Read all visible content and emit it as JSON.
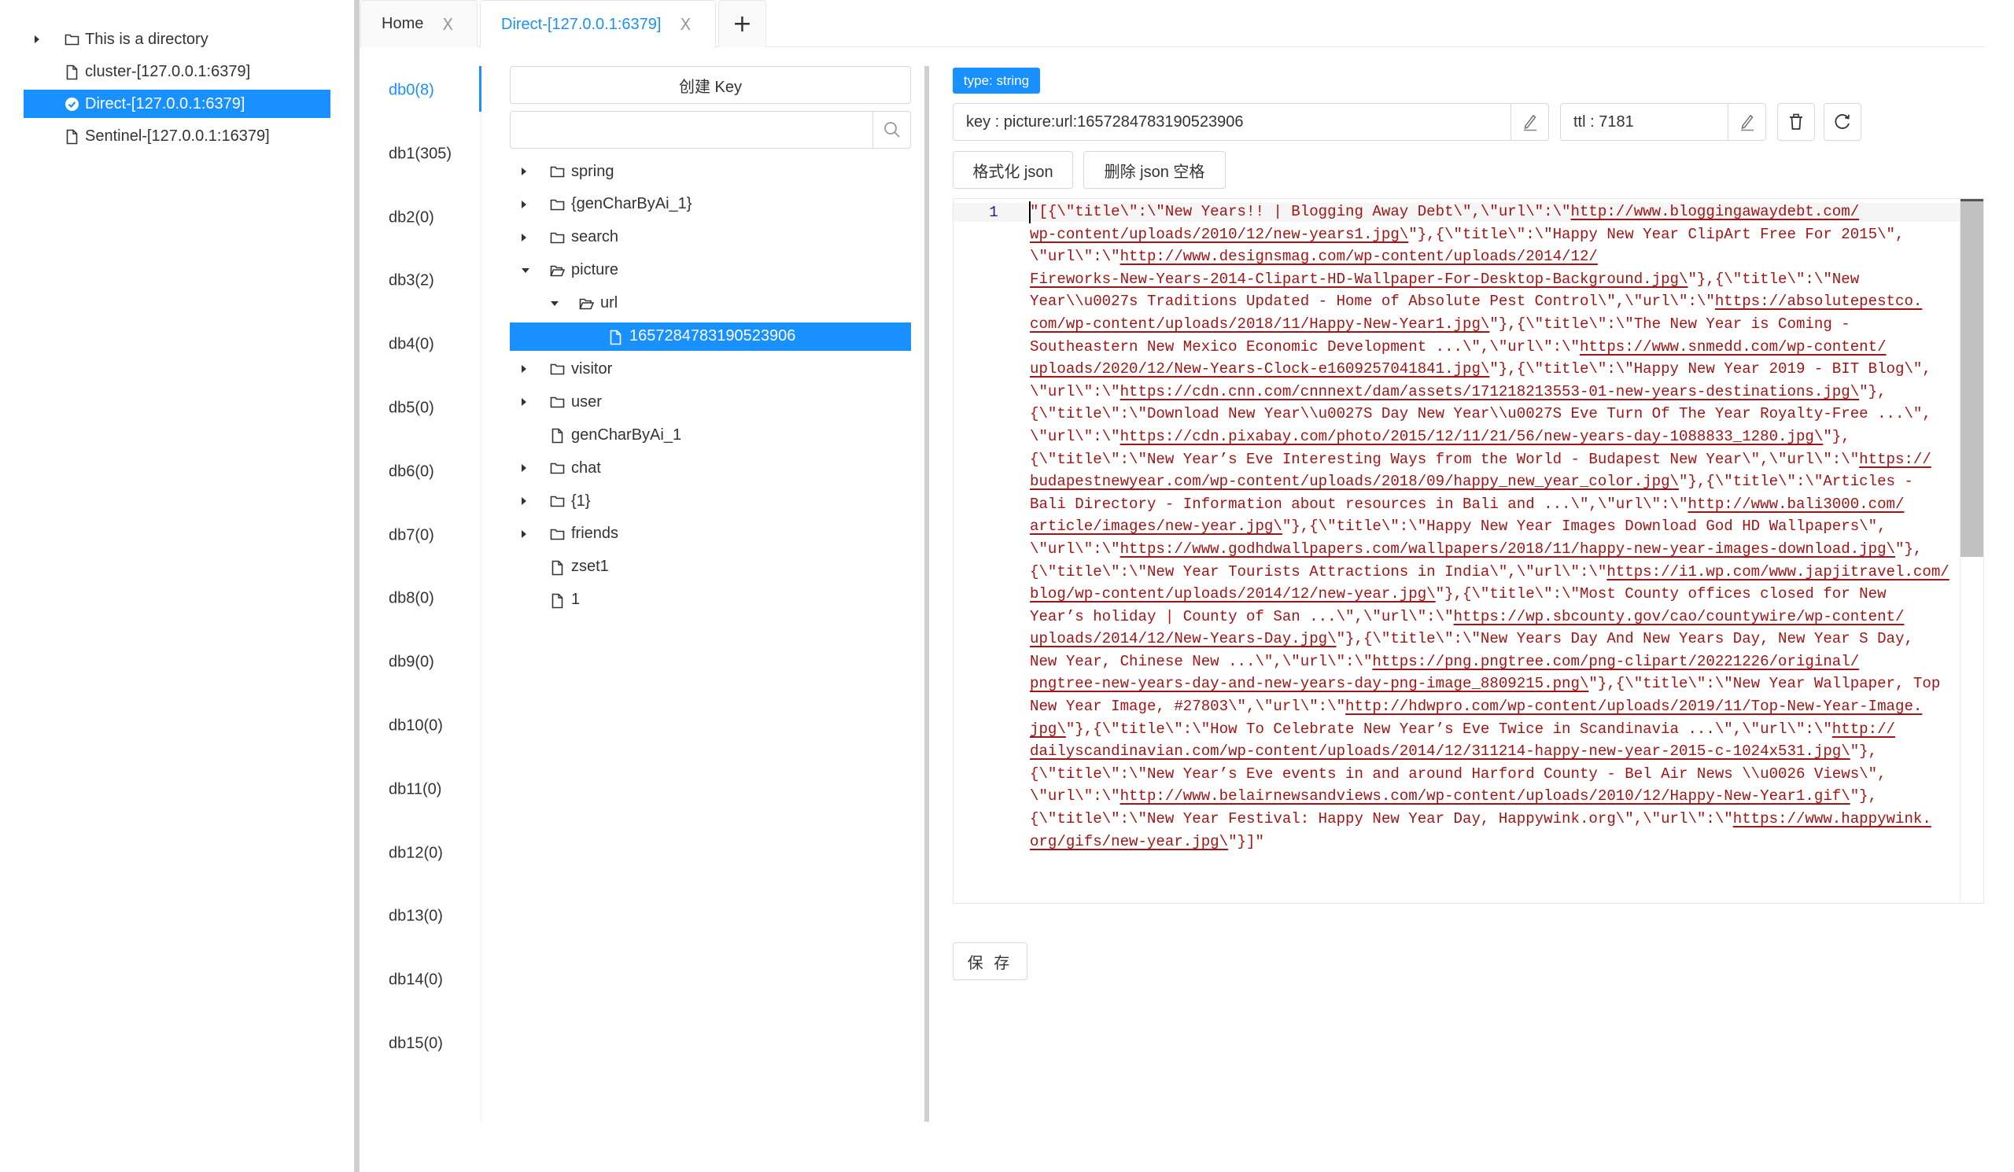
{
  "sidebar": {
    "items": [
      {
        "label": "This is a directory",
        "icon": "folder-icon",
        "expandable": true,
        "selected": false
      },
      {
        "label": "cluster-[127.0.0.1:6379]",
        "icon": "file-icon",
        "expandable": false,
        "selected": false
      },
      {
        "label": "Direct-[127.0.0.1:6379]",
        "icon": "check-circle-icon",
        "expandable": false,
        "selected": true
      },
      {
        "label": "Sentinel-[127.0.0.1:16379]",
        "icon": "file-icon",
        "expandable": false,
        "selected": false
      }
    ]
  },
  "tabs": [
    {
      "label": "Home",
      "close": "X",
      "active": false
    },
    {
      "label": "Direct-[127.0.0.1:6379]",
      "close": "X",
      "active": true
    }
  ],
  "tab_add_label": "+",
  "db_list": [
    {
      "label": "db0(8)",
      "active": true
    },
    {
      "label": "db1(305)"
    },
    {
      "label": "db2(0)"
    },
    {
      "label": "db3(2)"
    },
    {
      "label": "db4(0)"
    },
    {
      "label": "db5(0)"
    },
    {
      "label": "db6(0)"
    },
    {
      "label": "db7(0)"
    },
    {
      "label": "db8(0)"
    },
    {
      "label": "db9(0)"
    },
    {
      "label": "db10(0)"
    },
    {
      "label": "db11(0)"
    },
    {
      "label": "db12(0)"
    },
    {
      "label": "db13(0)"
    },
    {
      "label": "db14(0)"
    },
    {
      "label": "db15(0)"
    }
  ],
  "key_panel": {
    "create_key_label": "创建 Key",
    "search_value": "",
    "search_placeholder": "",
    "tree": [
      {
        "label": "spring",
        "type": "folder",
        "depth": 0,
        "state": "collapsed"
      },
      {
        "label": "{genCharByAi_1}",
        "type": "folder",
        "depth": 0,
        "state": "collapsed"
      },
      {
        "label": "search",
        "type": "folder",
        "depth": 0,
        "state": "collapsed"
      },
      {
        "label": "picture",
        "type": "folder",
        "depth": 0,
        "state": "expanded"
      },
      {
        "label": "url",
        "type": "folder",
        "depth": 1,
        "state": "expanded"
      },
      {
        "label": "1657284783190523906",
        "type": "key",
        "depth": 2,
        "selected": true
      },
      {
        "label": "visitor",
        "type": "folder",
        "depth": 0,
        "state": "collapsed"
      },
      {
        "label": "user",
        "type": "folder",
        "depth": 0,
        "state": "collapsed"
      },
      {
        "label": "genCharByAi_1",
        "type": "key",
        "depth": 0
      },
      {
        "label": "chat",
        "type": "folder",
        "depth": 0,
        "state": "collapsed"
      },
      {
        "label": "{1}",
        "type": "folder",
        "depth": 0,
        "state": "collapsed"
      },
      {
        "label": "friends",
        "type": "folder",
        "depth": 0,
        "state": "collapsed"
      },
      {
        "label": "zset1",
        "type": "key",
        "depth": 0
      },
      {
        "label": "1",
        "type": "key",
        "depth": 0
      }
    ]
  },
  "detail": {
    "type_tag": "type: string",
    "key_text": "key : picture:url:1657284783190523906",
    "ttl_text": "ttl : 7181",
    "format_json_label": "格式化 json",
    "strip_json_label": "删除 json 空格",
    "save_label": "保 存",
    "editor": {
      "line_number": "1",
      "wrapped_lines": [
        [
          [
            "t",
            "\"[{\\\"title\\\":\\\"New Years!! | Blogging Away Debt\\\",\\\"url\\\":\\\""
          ],
          [
            "u",
            "http://www.bloggingawaydebt.com/"
          ]
        ],
        [
          [
            "u",
            "wp-content/uploads/2010/12/new-years1.jpg\\"
          ],
          [
            "t",
            "\"},{\\\"title\\\":\\\"Happy New Year ClipArt Free For 2015\\\","
          ]
        ],
        [
          [
            "t",
            "\\\"url\\\":\\\""
          ],
          [
            "u",
            "http://www.designsmag.com/wp-content/uploads/2014/12/"
          ]
        ],
        [
          [
            "u",
            "Fireworks-New-Years-2014-Clipart-HD-Wallpaper-For-Desktop-Background.jpg\\"
          ],
          [
            "t",
            "\"},{\\\"title\\\":\\\"New"
          ]
        ],
        [
          [
            "t",
            "Year\\\\u0027s Traditions Updated - Home of Absolute Pest Control\\\",\\\"url\\\":\\\""
          ],
          [
            "u",
            "https://absolutepestco."
          ]
        ],
        [
          [
            "u",
            "com/wp-content/uploads/2018/11/Happy-New-Year1.jpg\\"
          ],
          [
            "t",
            "\"},{\\\"title\\\":\\\"The New Year is Coming -"
          ]
        ],
        [
          [
            "t",
            "Southeastern New Mexico Economic Development ...\\\",\\\"url\\\":\\\""
          ],
          [
            "u",
            "https://www.snmedd.com/wp-content/"
          ]
        ],
        [
          [
            "u",
            "uploads/2020/12/New-Years-Clock-e1609257041841.jpg\\"
          ],
          [
            "t",
            "\"},{\\\"title\\\":\\\"Happy New Year 2019 - BIT Blog\\\","
          ]
        ],
        [
          [
            "t",
            "\\\"url\\\":\\\""
          ],
          [
            "u",
            "https://cdn.cnn.com/cnnnext/dam/assets/171218213553-01-new-years-destinations.jpg\\"
          ],
          [
            "t",
            "\"},"
          ]
        ],
        [
          [
            "t",
            "{\\\"title\\\":\\\"Download New Year\\\\u0027S Day New Year\\\\u0027S Eve Turn Of The Year Royalty-Free ...\\\","
          ]
        ],
        [
          [
            "t",
            "\\\"url\\\":\\\""
          ],
          [
            "u",
            "https://cdn.pixabay.com/photo/2015/12/11/21/56/new-years-day-1088833_1280.jpg\\"
          ],
          [
            "t",
            "\"},"
          ]
        ],
        [
          [
            "t",
            "{\\\"title\\\":\\\"New Year’s Eve Interesting Ways from the World - Budapest New Year\\\",\\\"url\\\":\\\""
          ],
          [
            "u",
            "https://"
          ]
        ],
        [
          [
            "u",
            "budapestnewyear.com/wp-content/uploads/2018/09/happy_new_year_color.jpg\\"
          ],
          [
            "t",
            "\"},{\\\"title\\\":\\\"Articles -"
          ]
        ],
        [
          [
            "t",
            "Bali Directory - Information about resources in Bali and ...\\\",\\\"url\\\":\\\""
          ],
          [
            "u",
            "http://www.bali3000.com/"
          ]
        ],
        [
          [
            "u",
            "article/images/new-year.jpg\\"
          ],
          [
            "t",
            "\"},{\\\"title\\\":\\\"Happy New Year Images Download God HD Wallpapers\\\","
          ]
        ],
        [
          [
            "t",
            "\\\"url\\\":\\\""
          ],
          [
            "u",
            "https://www.godhdwallpapers.com/wallpapers/2018/11/happy-new-year-images-download.jpg\\"
          ],
          [
            "t",
            "\"},"
          ]
        ],
        [
          [
            "t",
            "{\\\"title\\\":\\\"New Year Tourists Attractions in India\\\",\\\"url\\\":\\\""
          ],
          [
            "u",
            "https://i1.wp.com/www.japjitravel.com/"
          ]
        ],
        [
          [
            "u",
            "blog/wp-content/uploads/2014/12/new-year.jpg\\"
          ],
          [
            "t",
            "\"},{\\\"title\\\":\\\"Most County offices closed for New"
          ]
        ],
        [
          [
            "t",
            "Year’s holiday | County of San ...\\\",\\\"url\\\":\\\""
          ],
          [
            "u",
            "https://wp.sbcounty.gov/cao/countywire/wp-content/"
          ]
        ],
        [
          [
            "u",
            "uploads/2014/12/New-Years-Day.jpg\\"
          ],
          [
            "t",
            "\"},{\\\"title\\\":\\\"New Years Day And New Years Day, New Year S Day,"
          ]
        ],
        [
          [
            "t",
            "New Year, Chinese New ...\\\",\\\"url\\\":\\\""
          ],
          [
            "u",
            "https://png.pngtree.com/png-clipart/20221226/original/"
          ]
        ],
        [
          [
            "u",
            "pngtree-new-years-day-and-new-years-day-png-image_8809215.png\\"
          ],
          [
            "t",
            "\"},{\\\"title\\\":\\\"New Year Wallpaper, Top"
          ]
        ],
        [
          [
            "t",
            "New Year Image, #27803\\\",\\\"url\\\":\\\""
          ],
          [
            "u",
            "http://hdwpro.com/wp-content/uploads/2019/11/Top-New-Year-Image."
          ]
        ],
        [
          [
            "u",
            "jpg\\"
          ],
          [
            "t",
            "\"},{\\\"title\\\":\\\"How To Celebrate New Year’s Eve Twice in Scandinavia ...\\\",\\\"url\\\":\\\""
          ],
          [
            "u",
            "http://"
          ]
        ],
        [
          [
            "u",
            "dailyscandinavian.com/wp-content/uploads/2014/12/311214-happy-new-year-2015-c-1024x531.jpg\\"
          ],
          [
            "t",
            "\"},"
          ]
        ],
        [
          [
            "t",
            "{\\\"title\\\":\\\"New Year’s Eve events in and around Harford County - Bel Air News \\\\u0026 Views\\\","
          ]
        ],
        [
          [
            "t",
            "\\\"url\\\":\\\""
          ],
          [
            "u",
            "http://www.belairnewsandviews.com/wp-content/uploads/2010/12/Happy-New-Year1.gif\\"
          ],
          [
            "t",
            "\"},"
          ]
        ],
        [
          [
            "t",
            "{\\\"title\\\":\\\"New Year Festival: Happy New Year Day, Happywink.org\\\",\\\"url\\\":\\\""
          ],
          [
            "u",
            "https://www.happywink."
          ]
        ],
        [
          [
            "u",
            "org/gifs/new-year.jpg\\"
          ],
          [
            "t",
            "\"}]\""
          ]
        ]
      ]
    }
  },
  "colors": {
    "accent": "#1890ff",
    "code_text": "#a31515",
    "line_number": "#1a237e",
    "divider": "#cfcfcf"
  }
}
